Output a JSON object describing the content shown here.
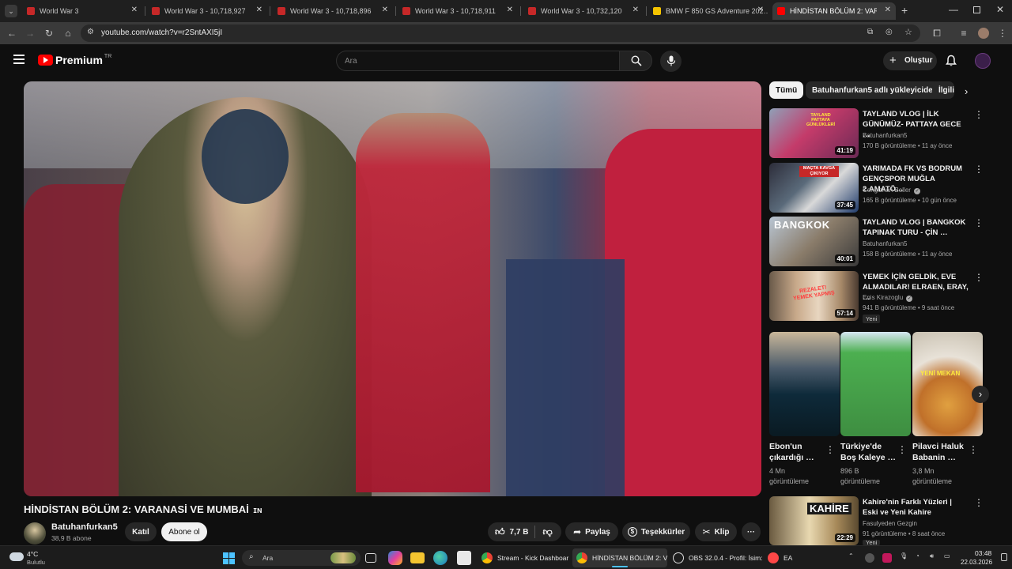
{
  "browser": {
    "tabs": [
      {
        "title": "World War 3",
        "active": false
      },
      {
        "title": "World War 3 - 10,718,927",
        "active": false
      },
      {
        "title": "World War 3 - 10,718,896",
        "active": false
      },
      {
        "title": "World War 3 - 10,718,911",
        "active": false
      },
      {
        "title": "World War 3 - 10,732,120",
        "active": false
      },
      {
        "title": "BMW F 850 GS Adventure 202…",
        "active": false
      },
      {
        "title": "HİNDİSTAN BÖLÜM 2: VAR…",
        "active": true
      }
    ],
    "new_tab": "+",
    "url": "youtube.com/watch?v=r2SntAXI5jI"
  },
  "youtube": {
    "brand": "Premium",
    "region": "TR",
    "search_placeholder": "Ara",
    "create_label": "Oluştur",
    "video": {
      "title": "HİNDİSTAN BÖLÜM 2: VARANASİ VE MUMBAİ",
      "title_suffix": "ɪɴ",
      "channel": "Batuhanfurkan5",
      "subscribers": "38,9 B abone",
      "join_label": "Katıl",
      "subscribe_label": "Abone ol",
      "likes": "7,7 B",
      "share_label": "Paylaş",
      "thanks_label": "Teşekkürler",
      "clip_label": "Klip",
      "more_label": "···"
    },
    "chips": [
      "Tümü",
      "Batuhanfurkan5 adlı yükleyiciden",
      "İlgili"
    ],
    "related": [
      {
        "title": "TAYLAND VLOG | İLK GÜNÜMÜZ- PATTAYA GECE …",
        "channel": "Batuhanfurkan5",
        "verified": false,
        "meta": "170 B görüntüleme • 11 ay önce",
        "duration": "41:19",
        "badge": ""
      },
      {
        "title": "YARIMADA FK VS BODRUM GENÇSPOR MUĞLA 2.AMATÖ…",
        "channel": "Cengizhan Beller",
        "verified": true,
        "meta": "165 B görüntüleme • 10 gün önce",
        "duration": "37:45",
        "badge": ""
      },
      {
        "title": "TAYLAND VLOG | BANGKOK TAPINAK TURU - ÇİN …",
        "channel": "Batuhanfurkan5",
        "verified": false,
        "meta": "158 B görüntüleme • 11 ay önce",
        "duration": "40:01",
        "badge": ""
      },
      {
        "title": "YEMEK İÇİN GELDİK, EVE ALMADILAR! ELRAEN, ERAY, …",
        "channel": "Enis Kirazoglu",
        "verified": true,
        "meta": "941 B görüntüleme • 9 saat önce",
        "duration": "57:14",
        "badge": "Yeni"
      }
    ],
    "shorts": [
      {
        "title": "Ebon'un çıkardığı …",
        "meta": "4 Mn görüntüleme"
      },
      {
        "title": "Türkiye'de Boş Kaleye …",
        "meta": "896 B görüntüleme"
      },
      {
        "title": "Pilavci Haluk Babanin …",
        "meta": "3,8 Mn görüntüleme"
      }
    ],
    "related_bottom": {
      "title": "Kahire'nin Farklı Yüzleri | Eski ve Yeni Kahire",
      "channel": "Fasulyeden Gezgin",
      "meta": "91 görüntüleme • 8 saat önce",
      "duration": "22:29",
      "badge": "Yeni"
    },
    "thumbnail_texts": {
      "t1": "TAYLAND PATTAYA GÜNLÜKLERİ",
      "t2": "MAÇTA KAVGA ÇIKIYOR",
      "t3": "BANGKOK",
      "t4": "REZALET! YEMEK YAPMIŞ",
      "s3": "YENİ MEKAN",
      "b1": "KAHİRE"
    }
  },
  "taskbar": {
    "weather_temp": "4°C",
    "weather_desc": "Bulutlu",
    "search_label": "Ara",
    "apps": [
      {
        "label": "Stream - Kick Dashboar"
      },
      {
        "label": "HİNDİSTAN BÖLÜM 2: V"
      },
      {
        "label": "OBS 32.0.4 - Profil: İsim:"
      },
      {
        "label": "EA"
      }
    ],
    "time": "03:48",
    "date": "22.03.2026"
  }
}
